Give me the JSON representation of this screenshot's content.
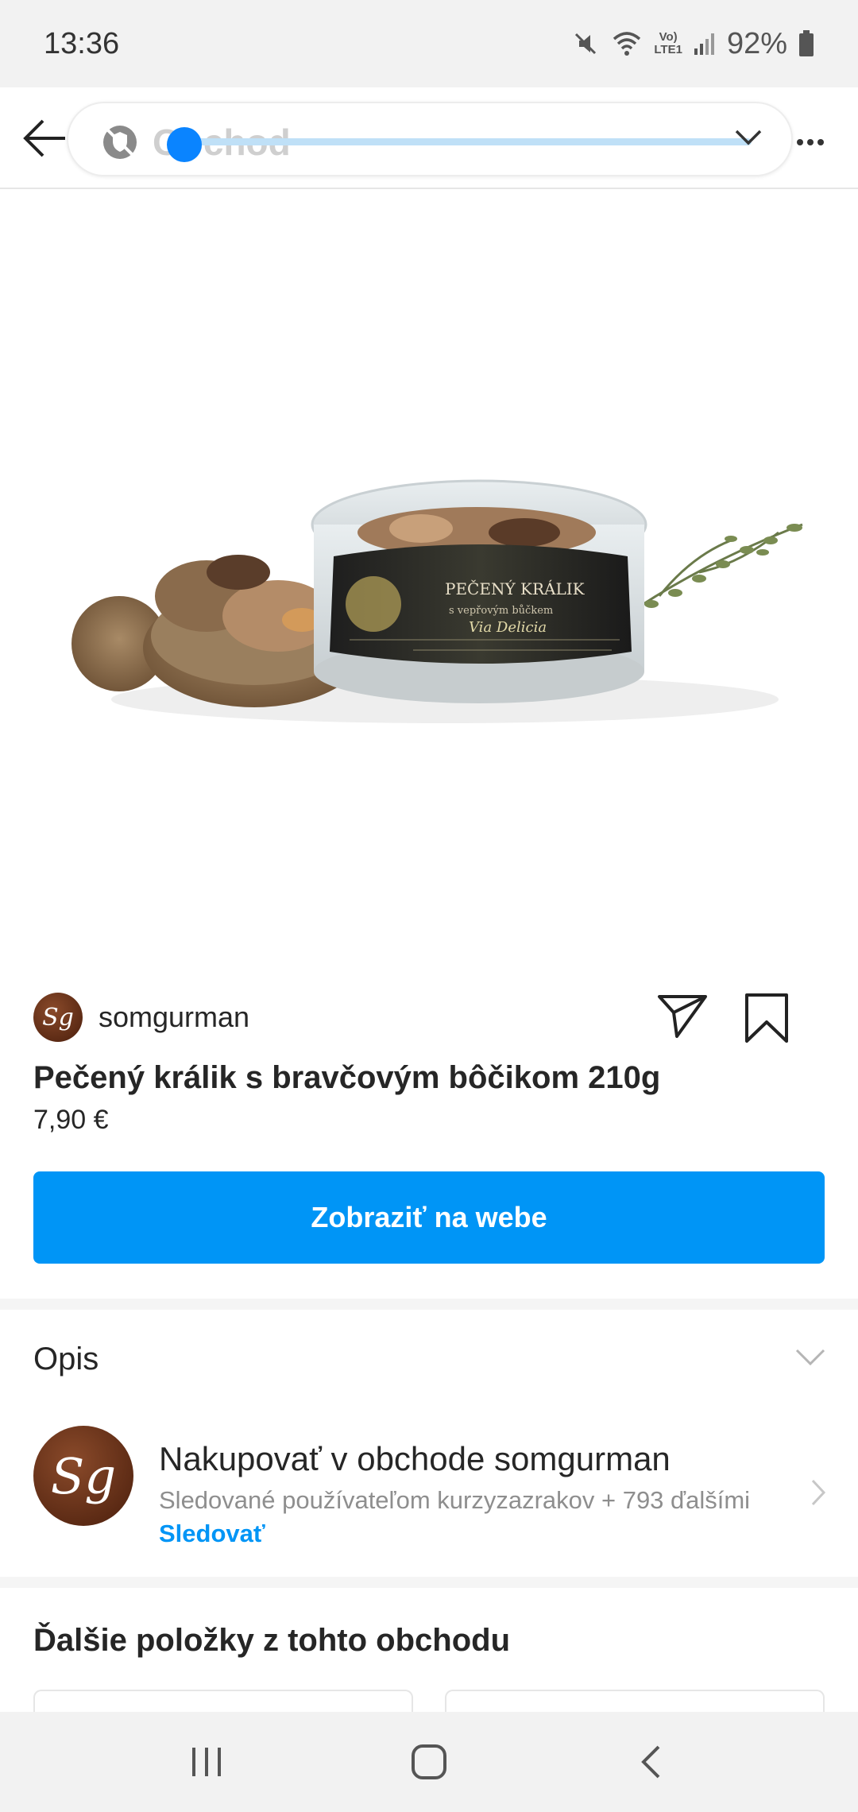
{
  "status_bar": {
    "time": "13:36",
    "network_label_top": "Vo)",
    "network_label_bottom": "LTE1",
    "battery": "92%",
    "icons": [
      "mute-icon",
      "wifi-icon",
      "signal-icon",
      "battery-icon"
    ]
  },
  "header": {
    "page_title": "Obchod",
    "loading_progress": 0.03
  },
  "product": {
    "image_alt": "Pečený králik jar with bread and thyme",
    "jar_label_top": "PEČENÝ KRÁLIK",
    "jar_label_sub": "s vepřovým bůčkem",
    "jar_brand": "Via Delicia",
    "seller": "somgurman",
    "avatar_initials": "Sg",
    "title": "Pečený králik s bravčovým bôčikom 210g",
    "price": "7,90 €",
    "view_button": "Zobraziť na webe"
  },
  "description": {
    "label": "Opis"
  },
  "shop": {
    "avatar_initials": "Sg",
    "title": "Nakupovať v obchode somgurman",
    "subtitle": "Sledované používateľom kurzyzazrakov + 793 ďalšími",
    "follow": "Sledovať"
  },
  "more_items": {
    "title": "Ďalšie položky z tohto obchodu"
  },
  "colors": {
    "accent": "#0095f6",
    "progress": "#1a8cff",
    "progress_track": "#bfe0f7",
    "text": "#262626",
    "muted": "#8e8e8e"
  }
}
